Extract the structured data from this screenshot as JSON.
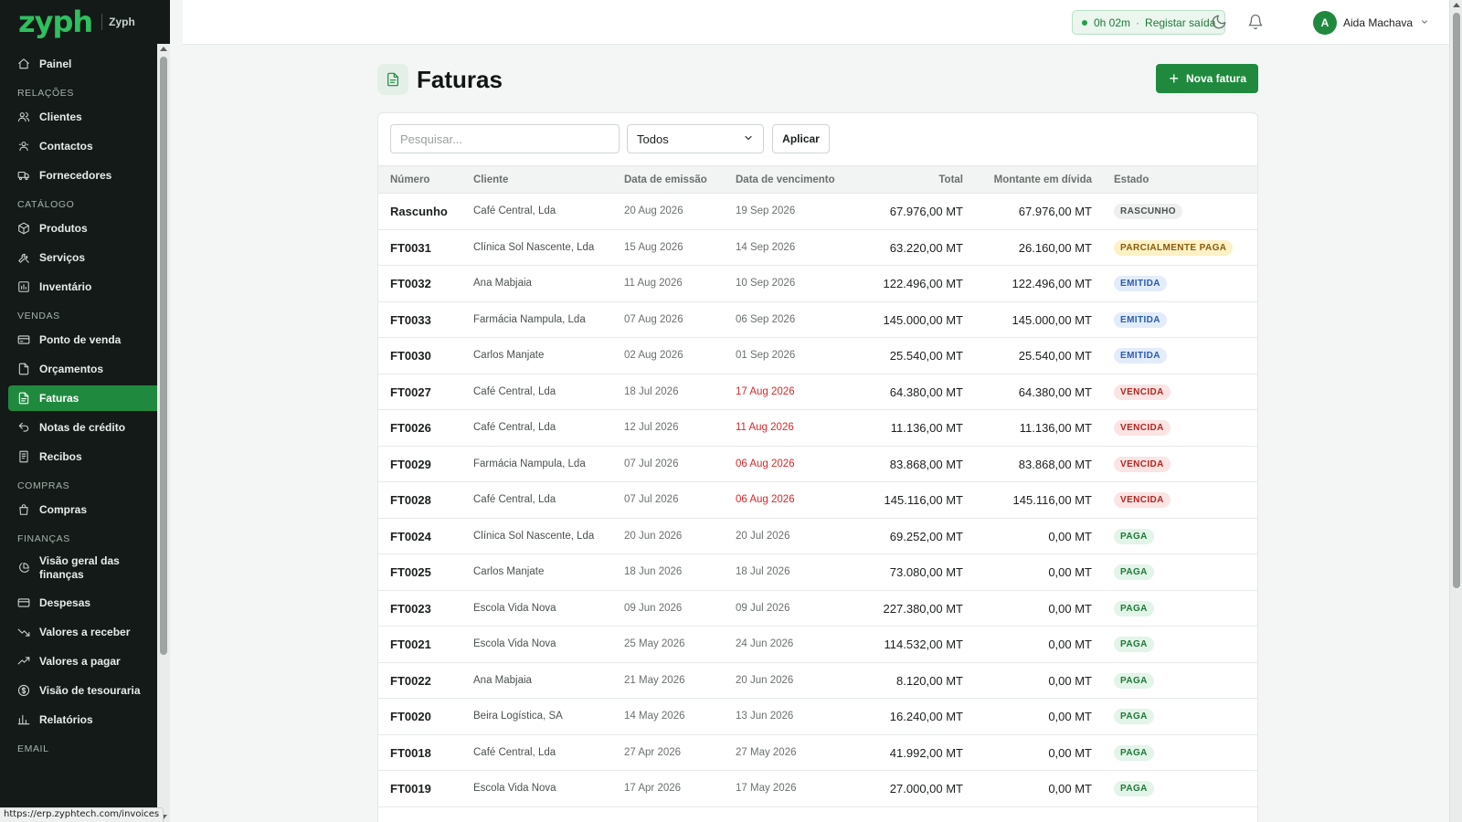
{
  "brand": {
    "logo": "zyph",
    "sub": "Zyph"
  },
  "sidebar": {
    "sections": [
      {
        "label": "",
        "items": [
          {
            "label": "Painel",
            "icon": "home-icon"
          }
        ]
      },
      {
        "label": "RELAÇÕES",
        "items": [
          {
            "label": "Clientes",
            "icon": "users-icon"
          },
          {
            "label": "Contactos",
            "icon": "contacts-icon"
          },
          {
            "label": "Fornecedores",
            "icon": "truck-icon"
          }
        ]
      },
      {
        "label": "CATÁLOGO",
        "items": [
          {
            "label": "Produtos",
            "icon": "box-icon"
          },
          {
            "label": "Serviços",
            "icon": "tools-icon"
          },
          {
            "label": "Inventário",
            "icon": "inventory-icon"
          }
        ]
      },
      {
        "label": "VENDAS",
        "items": [
          {
            "label": "Ponto de venda",
            "icon": "pos-icon"
          },
          {
            "label": "Orçamentos",
            "icon": "document-icon"
          },
          {
            "label": "Faturas",
            "icon": "invoice-icon",
            "active": true
          },
          {
            "label": "Notas de crédito",
            "icon": "undo-icon"
          },
          {
            "label": "Recibos",
            "icon": "receipt-icon"
          }
        ]
      },
      {
        "label": "COMPRAS",
        "items": [
          {
            "label": "Compras",
            "icon": "shopping-bag-icon"
          }
        ]
      },
      {
        "label": "FINANÇAS",
        "items": [
          {
            "label": "Visão geral das finanças",
            "icon": "pie-chart-icon"
          },
          {
            "label": "Despesas",
            "icon": "credit-card-icon"
          },
          {
            "label": "Valores a receber",
            "icon": "trend-down-icon"
          },
          {
            "label": "Valores a pagar",
            "icon": "trend-up-icon"
          },
          {
            "label": "Visão de tesouraria",
            "icon": "dollar-icon"
          },
          {
            "label": "Relatórios",
            "icon": "bar-chart-icon"
          }
        ]
      },
      {
        "label": "EMAIL",
        "items": []
      }
    ]
  },
  "status_url": "https://erp.zyphtech.com/invoices",
  "topbar": {
    "timer": "0h 02m",
    "timer_sep": "·",
    "timer_action": "Registar saída",
    "user_initial": "A",
    "user_name": "Aida Machava"
  },
  "page": {
    "title": "Faturas",
    "new_button": "Nova fatura",
    "plus": "+"
  },
  "filters": {
    "search_placeholder": "Pesquisar...",
    "status_value": "Todos",
    "apply_label": "Aplicar"
  },
  "table": {
    "headers": {
      "number": "Número",
      "client": "Cliente",
      "issue": "Data de emissão",
      "due": "Data de vencimento",
      "total": "Total",
      "debt": "Montante em dívida",
      "status": "Estado"
    },
    "rows": [
      {
        "number": "Rascunho",
        "client": "Café Central, Lda",
        "issue": "20 Aug 2026",
        "due": "19 Sep 2026",
        "total": "67.976,00 MT",
        "debt": "67.976,00 MT",
        "status": "RASCUNHO",
        "kind": "draft",
        "overdue": false
      },
      {
        "number": "FT0031",
        "client": "Clínica Sol Nascente, Lda",
        "issue": "15 Aug 2026",
        "due": "14 Sep 2026",
        "total": "63.220,00 MT",
        "debt": "26.160,00 MT",
        "status": "PARCIALMENTE PAGA",
        "kind": "partial",
        "overdue": false
      },
      {
        "number": "FT0032",
        "client": "Ana Mabjaia",
        "issue": "11 Aug 2026",
        "due": "10 Sep 2026",
        "total": "122.496,00 MT",
        "debt": "122.496,00 MT",
        "status": "EMITIDA",
        "kind": "issued",
        "overdue": false
      },
      {
        "number": "FT0033",
        "client": "Farmácia Nampula, Lda",
        "issue": "07 Aug 2026",
        "due": "06 Sep 2026",
        "total": "145.000,00 MT",
        "debt": "145.000,00 MT",
        "status": "EMITIDA",
        "kind": "issued",
        "overdue": false
      },
      {
        "number": "FT0030",
        "client": "Carlos Manjate",
        "issue": "02 Aug 2026",
        "due": "01 Sep 2026",
        "total": "25.540,00 MT",
        "debt": "25.540,00 MT",
        "status": "EMITIDA",
        "kind": "issued",
        "overdue": false
      },
      {
        "number": "FT0027",
        "client": "Café Central, Lda",
        "issue": "18 Jul 2026",
        "due": "17 Aug 2026",
        "total": "64.380,00 MT",
        "debt": "64.380,00 MT",
        "status": "VENCIDA",
        "kind": "overdue",
        "overdue": true
      },
      {
        "number": "FT0026",
        "client": "Café Central, Lda",
        "issue": "12 Jul 2026",
        "due": "11 Aug 2026",
        "total": "11.136,00 MT",
        "debt": "11.136,00 MT",
        "status": "VENCIDA",
        "kind": "overdue",
        "overdue": true
      },
      {
        "number": "FT0029",
        "client": "Farmácia Nampula, Lda",
        "issue": "07 Jul 2026",
        "due": "06 Aug 2026",
        "total": "83.868,00 MT",
        "debt": "83.868,00 MT",
        "status": "VENCIDA",
        "kind": "overdue",
        "overdue": true
      },
      {
        "number": "FT0028",
        "client": "Café Central, Lda",
        "issue": "07 Jul 2026",
        "due": "06 Aug 2026",
        "total": "145.116,00 MT",
        "debt": "145.116,00 MT",
        "status": "VENCIDA",
        "kind": "overdue",
        "overdue": true
      },
      {
        "number": "FT0024",
        "client": "Clínica Sol Nascente, Lda",
        "issue": "20 Jun 2026",
        "due": "20 Jul 2026",
        "total": "69.252,00 MT",
        "debt": "0,00 MT",
        "status": "PAGA",
        "kind": "paid",
        "overdue": false
      },
      {
        "number": "FT0025",
        "client": "Carlos Manjate",
        "issue": "18 Jun 2026",
        "due": "18 Jul 2026",
        "total": "73.080,00 MT",
        "debt": "0,00 MT",
        "status": "PAGA",
        "kind": "paid",
        "overdue": false
      },
      {
        "number": "FT0023",
        "client": "Escola Vida Nova",
        "issue": "09 Jun 2026",
        "due": "09 Jul 2026",
        "total": "227.380,00 MT",
        "debt": "0,00 MT",
        "status": "PAGA",
        "kind": "paid",
        "overdue": false
      },
      {
        "number": "FT0021",
        "client": "Escola Vida Nova",
        "issue": "25 May 2026",
        "due": "24 Jun 2026",
        "total": "114.532,00 MT",
        "debt": "0,00 MT",
        "status": "PAGA",
        "kind": "paid",
        "overdue": false
      },
      {
        "number": "FT0022",
        "client": "Ana Mabjaia",
        "issue": "21 May 2026",
        "due": "20 Jun 2026",
        "total": "8.120,00 MT",
        "debt": "0,00 MT",
        "status": "PAGA",
        "kind": "paid",
        "overdue": false
      },
      {
        "number": "FT0020",
        "client": "Beira Logística, SA",
        "issue": "14 May 2026",
        "due": "13 Jun 2026",
        "total": "16.240,00 MT",
        "debt": "0,00 MT",
        "status": "PAGA",
        "kind": "paid",
        "overdue": false
      },
      {
        "number": "FT0018",
        "client": "Café Central, Lda",
        "issue": "27 Apr 2026",
        "due": "27 May 2026",
        "total": "41.992,00 MT",
        "debt": "0,00 MT",
        "status": "PAGA",
        "kind": "paid",
        "overdue": false
      },
      {
        "number": "FT0019",
        "client": "Escola Vida Nova",
        "issue": "17 Apr 2026",
        "due": "17 May 2026",
        "total": "27.000,00 MT",
        "debt": "0,00 MT",
        "status": "PAGA",
        "kind": "paid",
        "overdue": false
      }
    ]
  },
  "colors": {
    "accent": "#1f8a3e",
    "sidebar_bg": "#131a17",
    "overdue": "#dc2626"
  }
}
